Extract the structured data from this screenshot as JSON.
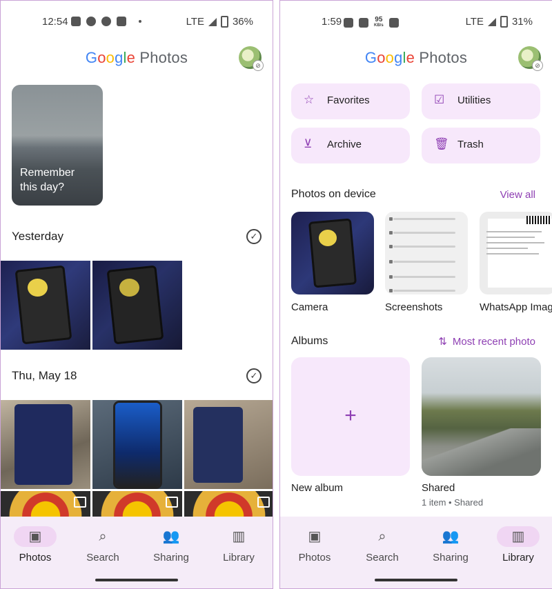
{
  "left": {
    "status": {
      "time": "12:54",
      "network": "LTE",
      "battery": "36%"
    },
    "app_title": {
      "brand": "Google",
      "product": "Photos"
    },
    "memory": {
      "caption": "Remember this day?"
    },
    "sections": [
      {
        "title": "Yesterday"
      },
      {
        "title": "Thu, May 18"
      }
    ],
    "nav": [
      {
        "label": "Photos",
        "icon": "photo-icon",
        "active": true
      },
      {
        "label": "Search",
        "icon": "search-icon",
        "active": false
      },
      {
        "label": "Sharing",
        "icon": "people-icon",
        "active": false
      },
      {
        "label": "Library",
        "icon": "library-icon",
        "active": false
      }
    ]
  },
  "right": {
    "status": {
      "time": "1:59",
      "speed": "95",
      "speed_unit": "KB/s",
      "network": "LTE",
      "battery": "31%"
    },
    "app_title": {
      "brand": "Google",
      "product": "Photos"
    },
    "chips": [
      {
        "label": "Favorites",
        "icon": "star-icon"
      },
      {
        "label": "Utilities",
        "icon": "utilities-icon"
      },
      {
        "label": "Archive",
        "icon": "archive-icon"
      },
      {
        "label": "Trash",
        "icon": "trash-icon"
      }
    ],
    "photos_on_device": {
      "title": "Photos on device",
      "link": "View all",
      "folders": [
        {
          "label": "Camera"
        },
        {
          "label": "Screenshots"
        },
        {
          "label": "WhatsApp Imag"
        }
      ]
    },
    "albums": {
      "title": "Albums",
      "sort_label": "Most recent photo",
      "items": [
        {
          "label": "New album"
        },
        {
          "label": "Shared",
          "meta": "1 item • Shared"
        }
      ]
    },
    "nav": [
      {
        "label": "Photos",
        "icon": "photo-icon",
        "active": false
      },
      {
        "label": "Search",
        "icon": "search-icon",
        "active": false
      },
      {
        "label": "Sharing",
        "icon": "people-icon",
        "active": false
      },
      {
        "label": "Library",
        "icon": "library-icon",
        "active": true
      }
    ]
  },
  "colors": {
    "accent": "#8e3fb3",
    "chip_bg": "#f7e8fb",
    "nav_bg": "#f5ecf8",
    "nav_active": "#f0d6f3"
  }
}
